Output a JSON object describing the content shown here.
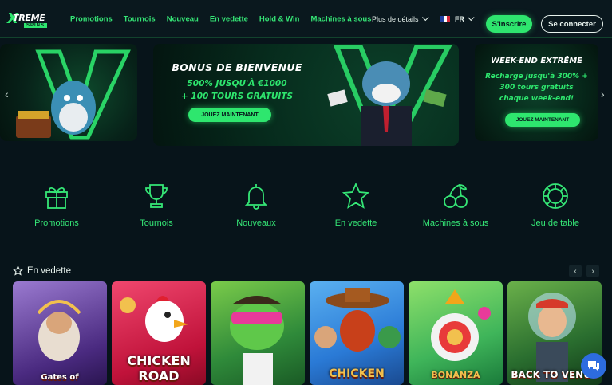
{
  "logo": {
    "x": "X",
    "top": "TREME",
    "bottom": "SPINS"
  },
  "nav": [
    {
      "label": "Promotions"
    },
    {
      "label": "Tournois"
    },
    {
      "label": "Nouveau"
    },
    {
      "label": "En vedette"
    },
    {
      "label": "Hold & Win"
    },
    {
      "label": "Machines à sous"
    }
  ],
  "more_label": "Plus de détails",
  "language": "FR",
  "signup_label": "S'inscrire",
  "login_label": "Se connecter",
  "banners": {
    "center": {
      "title": "BONUS DE BIENVENUE",
      "line1": "500% JUSQU'À €1000",
      "line2": "+ 100 TOURS GRATUITS",
      "cta": "JOUEZ MAINTENANT"
    },
    "right": {
      "title": "WEEK-END EXTRÊME",
      "line1": "Recharge jusqu'à 300% +",
      "line2": "300 tours gratuits",
      "line3": "chaque week-end!",
      "cta": "JOUEZ MAINTENANT"
    }
  },
  "categories": [
    {
      "label": "Promotions",
      "icon": "gift-icon"
    },
    {
      "label": "Tournois",
      "icon": "trophy-icon"
    },
    {
      "label": "Nouveaux",
      "icon": "bell-icon"
    },
    {
      "label": "En vedette",
      "icon": "star-icon"
    },
    {
      "label": "Machines à sous",
      "icon": "cherry-icon"
    },
    {
      "label": "Jeu de table",
      "icon": "chip-icon"
    }
  ],
  "featured": {
    "title": "En vedette",
    "games": [
      {
        "title": "Gates of",
        "color": "#7a4fb5"
      },
      {
        "title": "CHICKEN ROAD",
        "color": "#d62a4f"
      },
      {
        "title": "",
        "color": "#2f8a3a"
      },
      {
        "title": "CHICKEN",
        "color": "#2a8ad6"
      },
      {
        "title": "BONANZA",
        "color": "#3fb55a"
      },
      {
        "title": "BACK TO VENUS",
        "color": "#2a6e2f"
      }
    ]
  },
  "colors": {
    "accent": "#2ee66e",
    "background": "#07141a"
  }
}
